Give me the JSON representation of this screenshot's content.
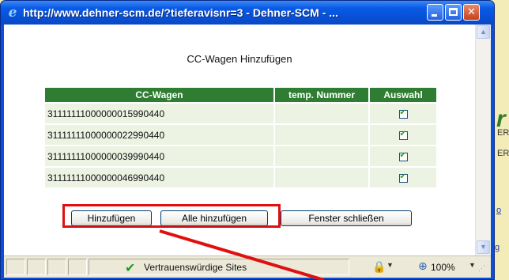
{
  "window": {
    "title": "http://www.dehner-scm.de/?tieferavisnr=3 - Dehner-SCM - ...",
    "icon": "ie-icon",
    "controls": {
      "min": "minimize-icon",
      "max": "maximize-icon",
      "close": "✕"
    }
  },
  "dialog": {
    "title": "CC-Wagen Hinzufügen",
    "columns": [
      "CC-Wagen",
      "temp. Nummer",
      "Auswahl"
    ],
    "rows": [
      {
        "number": "31111111000000015990440",
        "temp": "",
        "selected": true
      },
      {
        "number": "31111111000000022990440",
        "temp": "",
        "selected": true
      },
      {
        "number": "31111111000000039990440",
        "temp": "",
        "selected": true
      },
      {
        "number": "31111111000000046990440",
        "temp": "",
        "selected": true
      }
    ],
    "buttons": {
      "add": "Hinzufügen",
      "add_all": "Alle hinzufügen",
      "close": "Fenster schließen"
    }
  },
  "statusbar": {
    "trust": "Vertrauenswürdige Sites",
    "zoom": "100%"
  },
  "colors": {
    "header_green": "#2e7d32",
    "row_bg": "#ecf3e2",
    "highlight": "#e01010",
    "titlebar": "#0a5ae6"
  }
}
